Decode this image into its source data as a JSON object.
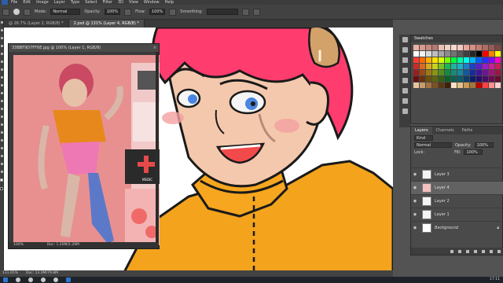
{
  "menubar": {
    "items": [
      "File",
      "Edit",
      "Image",
      "Layer",
      "Type",
      "Select",
      "Filter",
      "3D",
      "View",
      "Window",
      "Help"
    ]
  },
  "options": {
    "mode_label": "Mode:",
    "mode_value": "Normal",
    "opacity_label": "Opacity:",
    "opacity_value": "100%",
    "flow_label": "Flow:",
    "flow_value": "100%",
    "smoothing_label": "Smoothing:",
    "smoothing_value": ""
  },
  "tabs": [
    {
      "label": "@ 26.7% (Layer 2, RGB/8) *"
    },
    {
      "label": "2.psd @ 131% (Layer 4, RGB/8) *"
    }
  ],
  "reference": {
    "title": "33BBF9D7FF6E.jpg @ 100% (Layer 1, RGB/8)",
    "status_zoom": "100%",
    "status_doc": "Doc: 1.20M/2.29M",
    "medic_label": "MEDIC"
  },
  "statusbar": {
    "zoom": "131.65%",
    "doc": "Doc: 13.0M/79.8M"
  },
  "swatches": {
    "title": "Swatches",
    "colors": [
      "#e8b3a8",
      "#d89a8a",
      "#c98a7e",
      "#b57a70",
      "#e7c3b5",
      "#f2d1c4",
      "#f6d8cf",
      "#f3c9bd",
      "#e6a69a",
      "#d68f84",
      "#c67b72",
      "#b06b65",
      "#9a5a55",
      "#7e4744",
      "#ffffff",
      "#f2f2f2",
      "#d9d9d9",
      "#bfbfbf",
      "#a6a6a6",
      "#8c8c8c",
      "#737373",
      "#595959",
      "#404040",
      "#262626",
      "#000000",
      "#ff0000",
      "#ff8000",
      "#ffff00",
      "#ff3b30",
      "#ff6a00",
      "#ffb000",
      "#ffe000",
      "#d6ff00",
      "#7cff00",
      "#00ff40",
      "#00ff9c",
      "#00fff0",
      "#00b4ff",
      "#0060ff",
      "#2c2cff",
      "#8a00ff",
      "#ff00c8",
      "#cc2a2a",
      "#d96a1e",
      "#d9a91e",
      "#c9d11e",
      "#79c21e",
      "#1eb552",
      "#1eb59c",
      "#1eb0c9",
      "#1e7cc9",
      "#1e3fc9",
      "#5a1ec9",
      "#991ec9",
      "#c91e9c",
      "#c91e5a",
      "#9c1e1e",
      "#9c4a14",
      "#9c7a14",
      "#8c9414",
      "#52901e",
      "#148c3e",
      "#148c78",
      "#14889c",
      "#14589c",
      "#142c9c",
      "#3e149c",
      "#6c149c",
      "#9c1478",
      "#9c1446",
      "#6a1010",
      "#6a320c",
      "#6a520c",
      "#5e640c",
      "#366014",
      "#0c602a",
      "#0c6052",
      "#0c5c6a",
      "#0c3c6a",
      "#0c1c6a",
      "#2a0c6a",
      "#4a0c6a",
      "#6a0c52",
      "#6a0c30",
      "#e8c39e",
      "#c99b6d",
      "#a47341",
      "#7d5224",
      "#5a3816",
      "#3d230a",
      "#f7e3c3",
      "#e5c08a",
      "#c79a58",
      "#a5753a",
      "#c00000",
      "#ff4040",
      "#ff9090",
      "#ffd0d0"
    ]
  },
  "layers": {
    "tabs": [
      "Layers",
      "Channels",
      "Paths"
    ],
    "kind_label": "Kind",
    "blend": "Normal",
    "opacity_label": "Opacity:",
    "opacity_value": "100%",
    "lock_label": "Lock:",
    "fill_label": "Fill:",
    "fill_value": "100%",
    "items": [
      {
        "name": "Layer 3",
        "visible": true,
        "active": false
      },
      {
        "name": "Layer 4",
        "visible": true,
        "active": true
      },
      {
        "name": "Layer 2",
        "visible": true,
        "active": false
      },
      {
        "name": "Layer 1",
        "visible": true,
        "active": false
      },
      {
        "name": "Background",
        "visible": true,
        "active": false
      }
    ]
  },
  "taskbar": {
    "time": "17:11",
    "date": ""
  }
}
